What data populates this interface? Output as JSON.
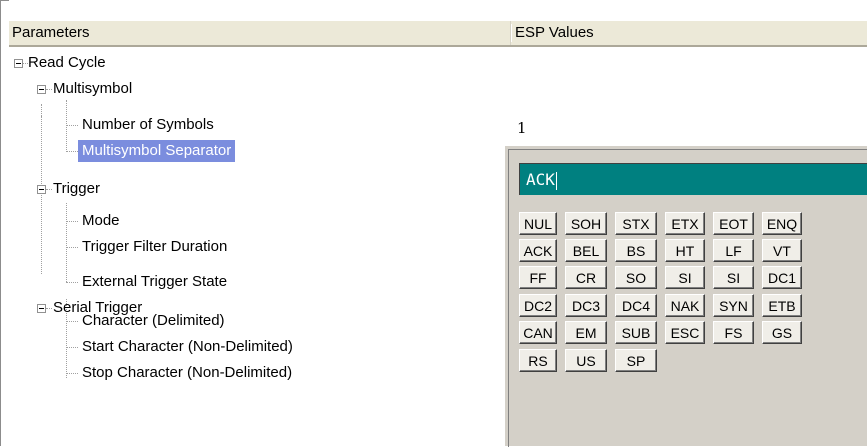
{
  "header": {
    "col_parameters": "Parameters",
    "col_values": "ESP Values"
  },
  "tree": {
    "read_cycle": "Read Cycle",
    "multisymbol": "Multisymbol",
    "number_of_symbols": "Number of Symbols",
    "number_of_symbols_value": "1",
    "multisymbol_separator": "Multisymbol Separator",
    "trigger": "Trigger",
    "mode": "Mode",
    "trigger_filter_duration": "Trigger Filter Duration",
    "external_trigger_state": "External Trigger State",
    "serial_trigger": "Serial Trigger",
    "character_delimited": "Character (Delimited)",
    "start_character": "Start Character (Non-Delimited)",
    "stop_character": "Stop Character (Non-Delimited)"
  },
  "picker": {
    "value": "ACK",
    "keys": [
      [
        "NUL",
        "SOH",
        "STX",
        "ETX",
        "EOT",
        "ENQ"
      ],
      [
        "ACK",
        "BEL",
        "BS",
        "HT",
        "LF",
        "VT"
      ],
      [
        "FF",
        "CR",
        "SO",
        "SI",
        "SI",
        "DC1"
      ],
      [
        "DC2",
        "DC3",
        "DC4",
        "NAK",
        "SYN",
        "ETB"
      ],
      [
        "CAN",
        "EM",
        "SUB",
        "ESC",
        "FS",
        "GS"
      ],
      [
        "RS",
        "US",
        "SP"
      ]
    ]
  },
  "colors": {
    "selection": "#7b8dde",
    "field_bg": "#008080",
    "panel_bg": "#d4d0c8"
  }
}
